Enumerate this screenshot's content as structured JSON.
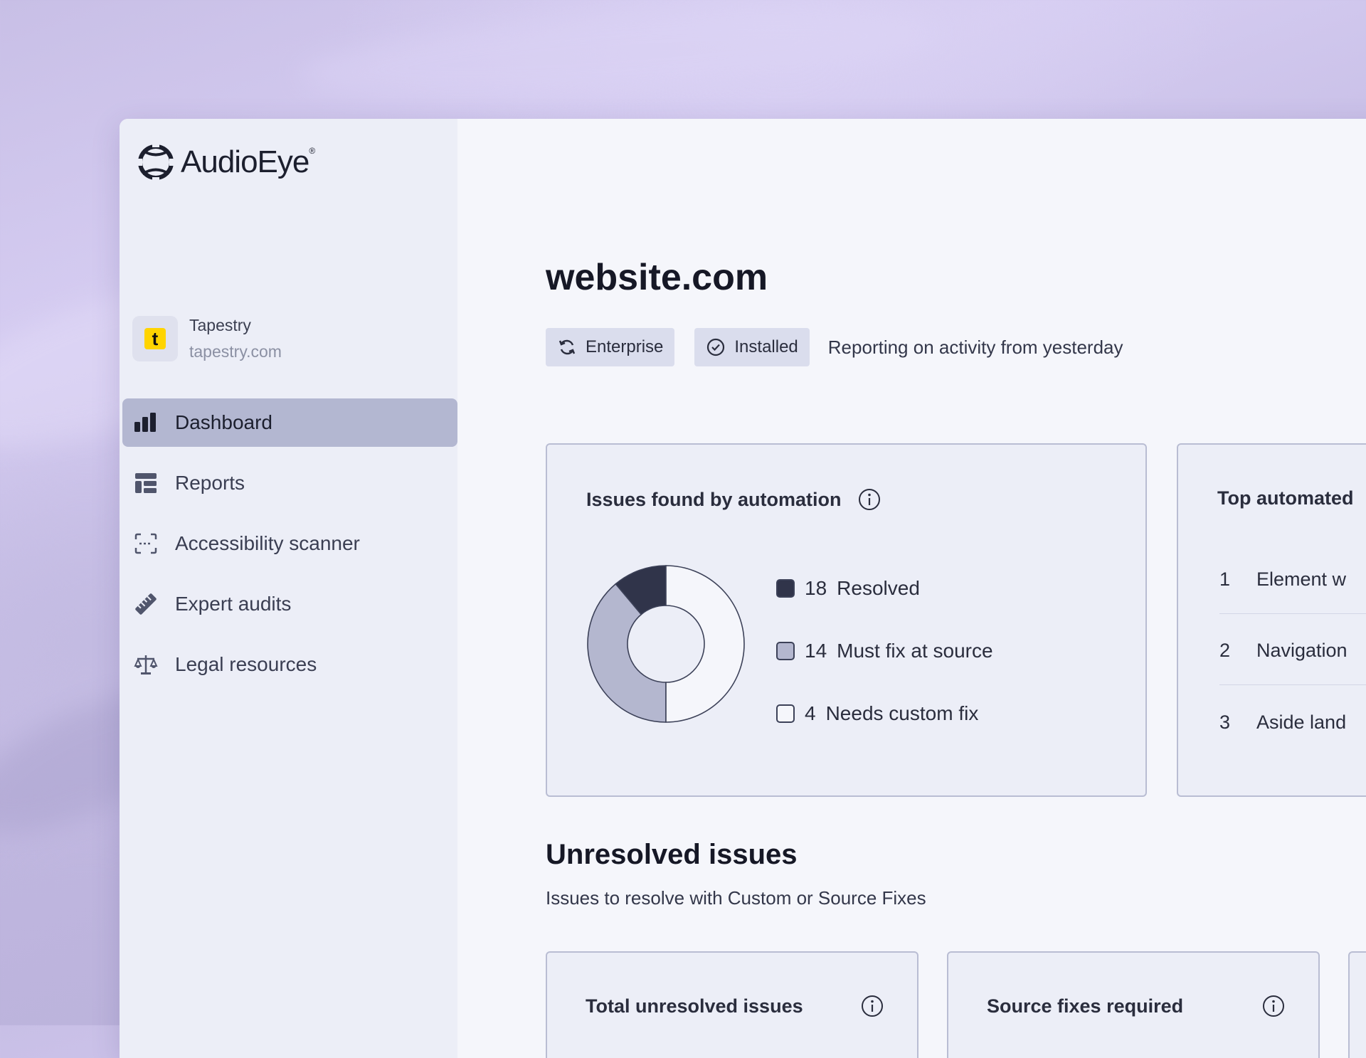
{
  "brand": {
    "name": "AudioEye",
    "mark": "®"
  },
  "org": {
    "name": "Tapestry",
    "url": "tapestry.com",
    "initial": "t"
  },
  "nav": [
    {
      "label": "Dashboard",
      "icon": "bar-chart-icon",
      "active": true
    },
    {
      "label": "Reports",
      "icon": "table-icon",
      "active": false
    },
    {
      "label": "Accessibility scanner",
      "icon": "scan-icon",
      "active": false
    },
    {
      "label": "Expert audits",
      "icon": "ruler-icon",
      "active": false
    },
    {
      "label": "Legal resources",
      "icon": "scale-icon",
      "active": false
    }
  ],
  "site": {
    "title": "website.com",
    "badges": [
      {
        "label": "Enterprise",
        "icon": "refresh-icon"
      },
      {
        "label": "Installed",
        "icon": "check-circle-icon"
      }
    ],
    "reporting": "Reporting on activity from yesterday"
  },
  "issues_card": {
    "title": "Issues found by automation",
    "legend": [
      {
        "count": "18",
        "label": "Resolved",
        "color": "#30344a"
      },
      {
        "count": "14",
        "label": "Must fix at source",
        "color": "#b4b7cf"
      },
      {
        "count": "4",
        "label": "Needs custom fix",
        "color": "#f5f6fb"
      }
    ]
  },
  "chart_data": {
    "type": "pie",
    "categories": [
      "Resolved",
      "Must fix at source",
      "Needs custom fix"
    ],
    "values": [
      4,
      14,
      18
    ],
    "colors": [
      "#30344a",
      "#b4b7cf",
      "#f5f6fb"
    ]
  },
  "top_card": {
    "title": "Top automated",
    "items": [
      {
        "num": "1",
        "label": "Element w"
      },
      {
        "num": "2",
        "label": "Navigation"
      },
      {
        "num": "3",
        "label": "Aside land"
      }
    ]
  },
  "unresolved": {
    "title": "Unresolved issues",
    "subtitle": "Issues to resolve with Custom or Source Fixes",
    "cards": [
      {
        "title": "Total unresolved issues"
      },
      {
        "title": "Source fixes required"
      }
    ]
  }
}
